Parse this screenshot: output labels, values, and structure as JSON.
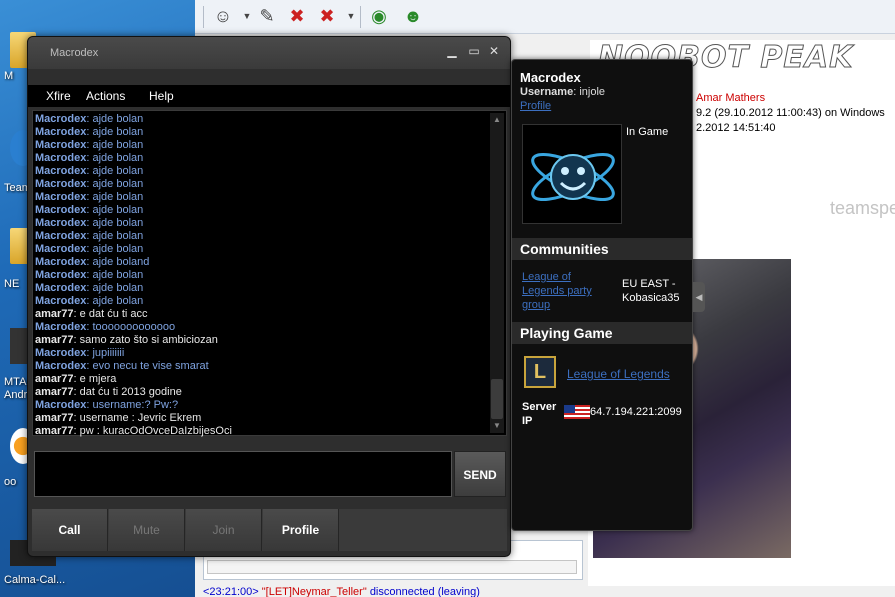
{
  "desktop": {
    "icons": [
      {
        "label": "M"
      },
      {
        "label": "Team"
      },
      {
        "label": "NE"
      },
      {
        "label": "MTA Andr"
      },
      {
        "label": "oo"
      },
      {
        "label": "Calma-Cal..."
      }
    ]
  },
  "background_app": {
    "banner_text": "NOOBOT PEAK",
    "info_lines": [
      {
        "text": "Amar Mathers",
        "red": true
      },
      {
        "text": "9.2 (29.10.2012 11:00:43) on Windows",
        "red": false
      },
      {
        "text": "2.2012 14:51:40",
        "red": false
      }
    ],
    "watermark": "teamspe",
    "log": {
      "time": "<23:21:00>",
      "nick": "\"[LET]Neymar_Teller\"",
      "event": "disconnected (leaving)"
    }
  },
  "window": {
    "title": "Macrodex",
    "menu": [
      "Xfire",
      "Actions",
      "Help"
    ],
    "send_label": "SEND",
    "actions": [
      {
        "label": "Call",
        "enabled": true
      },
      {
        "label": "Mute",
        "enabled": false
      },
      {
        "label": "Join",
        "enabled": false
      },
      {
        "label": "Profile",
        "enabled": true
      }
    ]
  },
  "chat": {
    "messages": [
      {
        "sender": "Macrodex",
        "text": "ajde bolan",
        "self": false
      },
      {
        "sender": "Macrodex",
        "text": "ajde bolan",
        "self": false
      },
      {
        "sender": "Macrodex",
        "text": "ajde bolan",
        "self": false
      },
      {
        "sender": "Macrodex",
        "text": "ajde bolan",
        "self": false
      },
      {
        "sender": "Macrodex",
        "text": "ajde bolan",
        "self": false
      },
      {
        "sender": "Macrodex",
        "text": "ajde bolan",
        "self": false
      },
      {
        "sender": "Macrodex",
        "text": "ajde bolan",
        "self": false
      },
      {
        "sender": "Macrodex",
        "text": "ajde bolan",
        "self": false
      },
      {
        "sender": "Macrodex",
        "text": "ajde bolan",
        "self": false
      },
      {
        "sender": "Macrodex",
        "text": "ajde bolan",
        "self": false
      },
      {
        "sender": "Macrodex",
        "text": "ajde bolan",
        "self": false
      },
      {
        "sender": "Macrodex",
        "text": "ajde boland",
        "self": false
      },
      {
        "sender": "Macrodex",
        "text": "ajde bolan",
        "self": false
      },
      {
        "sender": "Macrodex",
        "text": "ajde bolan",
        "self": false
      },
      {
        "sender": "Macrodex",
        "text": "ajde bolan",
        "self": false
      },
      {
        "sender": "amar77",
        "text": "e dat ću ti acc",
        "self": true
      },
      {
        "sender": "Macrodex",
        "text": "tooooooooooooo",
        "self": false
      },
      {
        "sender": "amar77",
        "text": "samo zato što si ambiciozan",
        "self": true
      },
      {
        "sender": "Macrodex",
        "text": "jupiiiiiii",
        "self": false
      },
      {
        "sender": "Macrodex",
        "text": "evo necu te vise smarat",
        "self": false
      },
      {
        "sender": "amar77",
        "text": "e mjera",
        "self": true
      },
      {
        "sender": "amar77",
        "text": "dat ću ti 2013 godine",
        "self": true
      },
      {
        "sender": "Macrodex",
        "text": "username:? Pw:?",
        "self": false
      },
      {
        "sender": "amar77",
        "text": "username : Jevric Ekrem",
        "self": true
      },
      {
        "sender": "amar77",
        "text": "pw : kuracOdOvceDaIzbijesOci",
        "self": true
      }
    ],
    "input_value": ""
  },
  "profile": {
    "name": "Macrodex",
    "username_label": "Username",
    "username": "injole",
    "profile_link": "Profile",
    "status": "In Game",
    "communities_header": "Communities",
    "community_name": "League of Legends party group",
    "community_region": "EU EAST - Kobasica35",
    "playing_header": "Playing Game",
    "game_name": "League of Legends",
    "server_label": "Server IP",
    "server_ip": "64.7.194.221:2099",
    "flag": "us-flag"
  },
  "colors": {
    "link": "#3c6fc0",
    "other_user": "#7fa3e0",
    "self_user": "#e8e8e8"
  }
}
